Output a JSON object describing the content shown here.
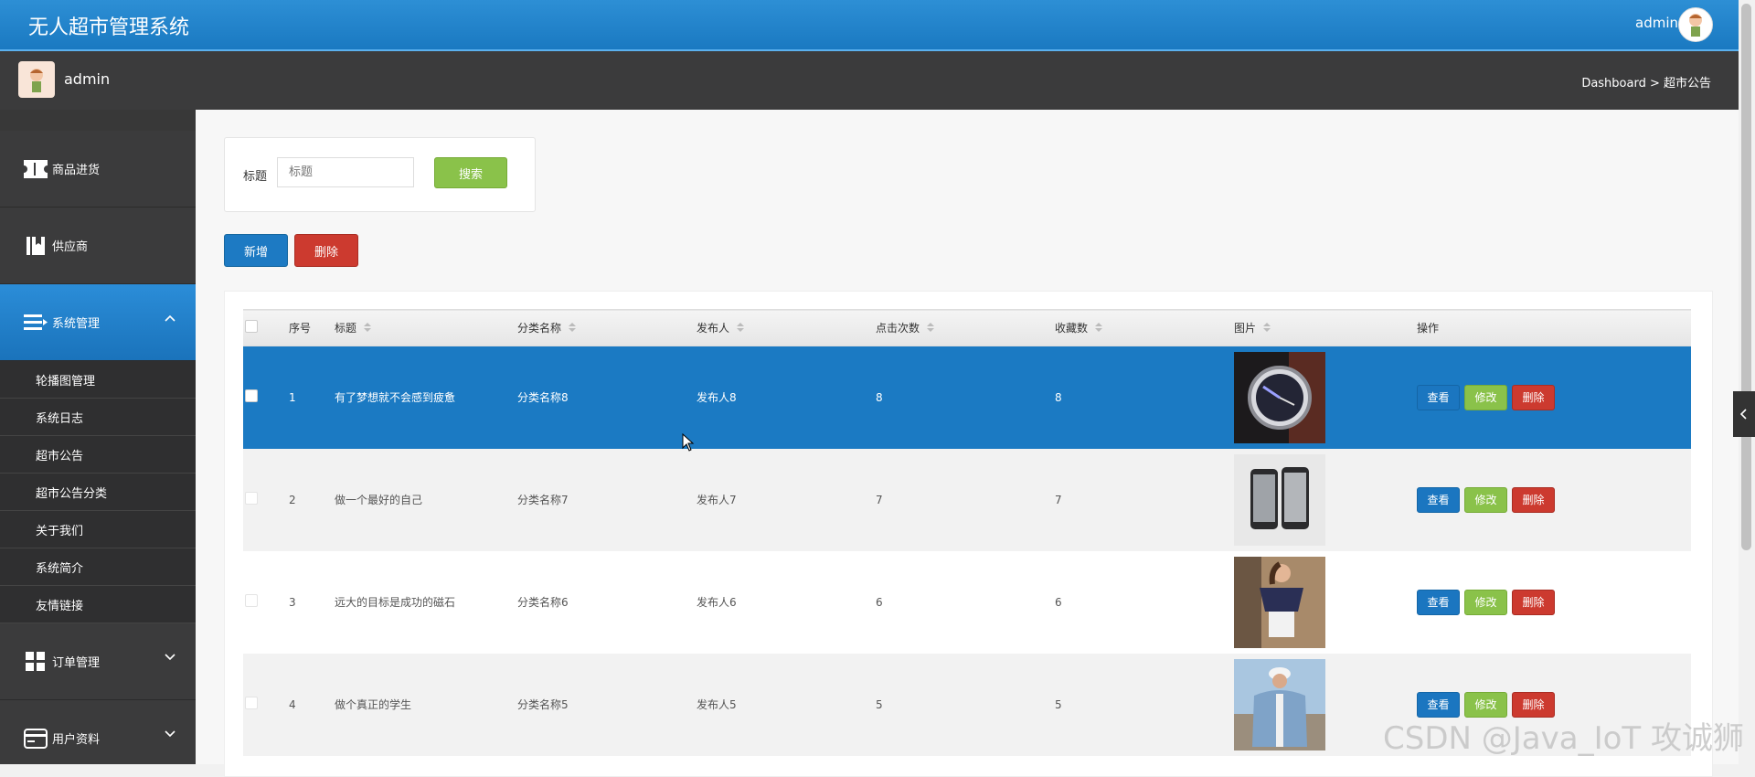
{
  "header": {
    "title": "无人超市管理系统",
    "user": "admin"
  },
  "subheader": {
    "user": "admin",
    "breadcrumb": "Dashboard > 超市公告"
  },
  "sidebar": {
    "items": [
      {
        "label": "商品进货",
        "icon": "ticket-icon"
      },
      {
        "label": "供应商",
        "icon": "book-icon"
      },
      {
        "label": "系统管理",
        "icon": "menu-icon",
        "active": true,
        "expanded": true
      }
    ],
    "sub_items": [
      {
        "label": "轮播图管理"
      },
      {
        "label": "系统日志"
      },
      {
        "label": "超市公告"
      },
      {
        "label": "超市公告分类"
      },
      {
        "label": "关于我们"
      },
      {
        "label": "系统简介"
      },
      {
        "label": "友情链接"
      }
    ],
    "items_after": [
      {
        "label": "订单管理",
        "icon": "grid-icon"
      },
      {
        "label": "用户资料",
        "icon": "card-icon"
      }
    ]
  },
  "search": {
    "label": "标题",
    "placeholder": "标题",
    "button": "搜索"
  },
  "actions": {
    "add": "新增",
    "delete": "删除"
  },
  "table": {
    "columns": [
      "序号",
      "标题",
      "分类名称",
      "发布人",
      "点击次数",
      "收藏数",
      "图片",
      "操作"
    ],
    "rows": [
      {
        "index": "1",
        "title": "有了梦想就不会感到疲惫",
        "category": "分类名称8",
        "publisher": "发布人8",
        "clicks": "8",
        "favorites": "8",
        "image": "watch",
        "selected": true
      },
      {
        "index": "2",
        "title": "做一个最好的自己",
        "category": "分类名称7",
        "publisher": "发布人7",
        "clicks": "7",
        "favorites": "7",
        "image": "phones"
      },
      {
        "index": "3",
        "title": "远大的目标是成功的磁石",
        "category": "分类名称6",
        "publisher": "发布人6",
        "clicks": "6",
        "favorites": "6",
        "image": "blouse"
      },
      {
        "index": "4",
        "title": "做个真正的学生",
        "category": "分类名称5",
        "publisher": "发布人5",
        "clicks": "5",
        "favorites": "5",
        "image": "jacket"
      }
    ],
    "row_actions": {
      "view": "查看",
      "edit": "修改",
      "delete": "删除"
    }
  },
  "watermark": "CSDN @Java_IoT 攻诚狮"
}
